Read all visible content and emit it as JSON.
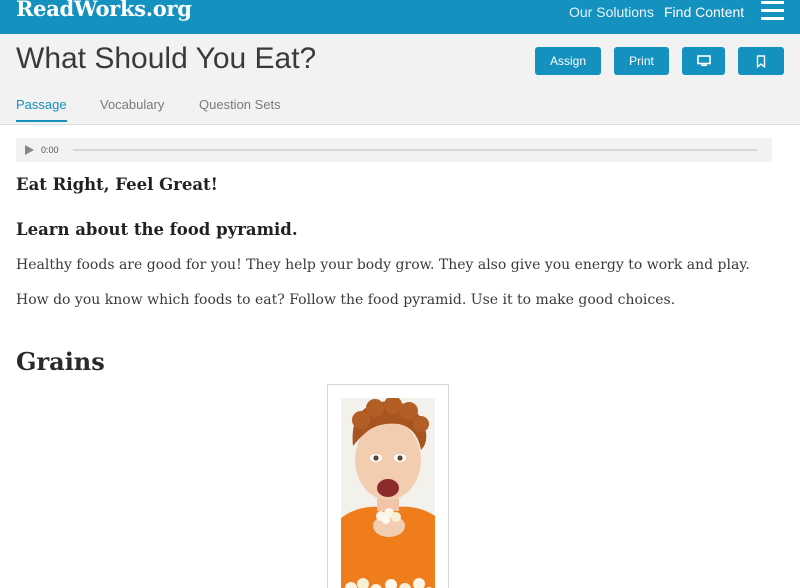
{
  "brand": {
    "logo_text": "ReadWorks.org"
  },
  "topnav": {
    "items": [
      {
        "label": "Our Solutions"
      },
      {
        "label": "Find Content"
      }
    ]
  },
  "header": {
    "title": "What Should You Eat?",
    "actions": {
      "assign": "Assign",
      "print": "Print"
    }
  },
  "tabs": [
    {
      "label": "Passage",
      "active": true
    },
    {
      "label": "Vocabulary",
      "active": false
    },
    {
      "label": "Question Sets",
      "active": false
    }
  ],
  "audio": {
    "time": "0:00"
  },
  "passage": {
    "heading1": "Eat Right, Feel Great!",
    "heading2": "Learn about the food pyramid.",
    "paragraphs": [
      "Healthy foods are good for you! They help your body grow. They also give you energy to work and play.",
      "How do you know which foods to eat? Follow the food pyramid. Use it to make good choices."
    ],
    "section": "Grains"
  },
  "colors": {
    "brand": "#1591bf",
    "header_bg": "#f2f2f2"
  },
  "icons": {
    "menu": "hamburger-icon",
    "present": "monitor-icon",
    "save": "bookmark-icon",
    "play": "play-icon"
  }
}
